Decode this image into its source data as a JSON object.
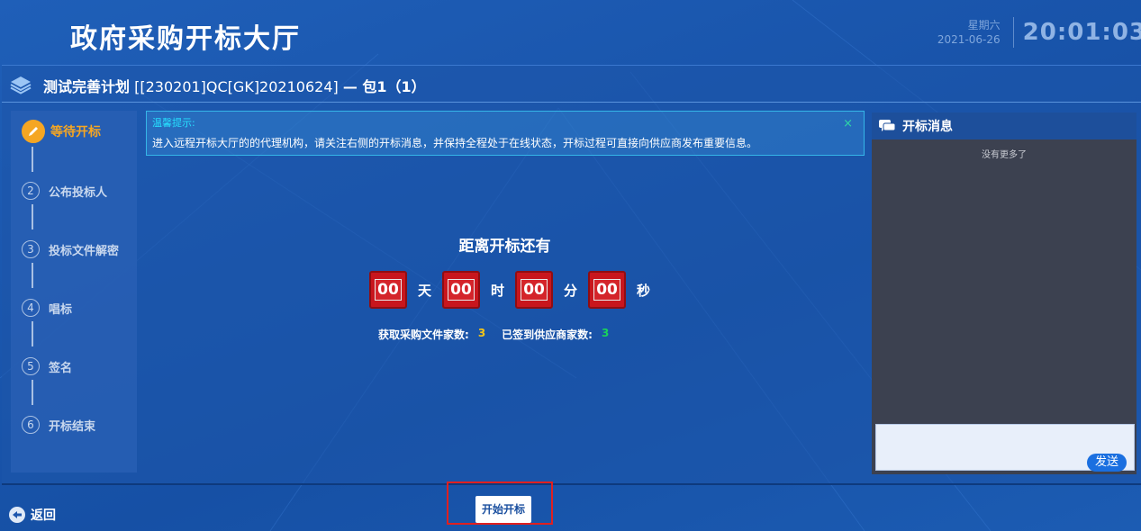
{
  "header": {
    "title": "政府采购开标大厅",
    "weekday": "星期六",
    "date": "2021-06-26",
    "time": "20:01:03"
  },
  "project": {
    "name": "测试完善计划",
    "code": "[[230201]QC[GK]20210624]",
    "package": "— 包1（1）"
  },
  "steps": [
    {
      "num": "",
      "label": "等待开标",
      "active": true
    },
    {
      "num": "2",
      "label": "公布投标人"
    },
    {
      "num": "3",
      "label": "投标文件解密"
    },
    {
      "num": "4",
      "label": "唱标"
    },
    {
      "num": "5",
      "label": "签名"
    },
    {
      "num": "6",
      "label": "开标结束"
    }
  ],
  "tip": {
    "title": "温馨提示:",
    "text": "进入远程开标大厅的的代理机构，请关注右侧的开标消息，并保持全程处于在线状态，开标过程可直接向供应商发布重要信息。",
    "close": "×"
  },
  "countdown": {
    "title": "距离开标还有",
    "days": "00",
    "days_unit": "天",
    "hours": "00",
    "hours_unit": "时",
    "minutes": "00",
    "minutes_unit": "分",
    "seconds": "00",
    "seconds_unit": "秒"
  },
  "stats": {
    "docs_label": "获取采购文件家数:",
    "docs_value": "3",
    "signed_label": "已签到供应商家数:",
    "signed_value": "3"
  },
  "messages": {
    "title": "开标消息",
    "empty": "没有更多了",
    "send_label": "发送"
  },
  "footer": {
    "back_label": "返回",
    "start_label": "开始开标"
  },
  "colors": {
    "active_step": "#f5a623",
    "flip_red": "#c8161d",
    "docs_value": "#f5c518",
    "signed_value": "#19d35a",
    "highlight_border": "#e02020"
  }
}
